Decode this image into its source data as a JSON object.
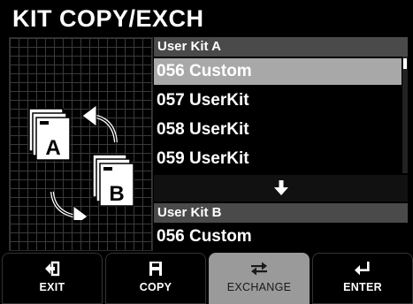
{
  "title": "KIT COPY/EXCH",
  "list": {
    "section_a": {
      "header": "User Kit A",
      "items": [
        {
          "label": "056 Custom",
          "selected": true
        },
        {
          "label": "057 UserKit",
          "selected": false
        },
        {
          "label": "058 UserKit",
          "selected": false
        },
        {
          "label": "059 UserKit",
          "selected": false
        }
      ]
    },
    "arrow_icon": "arrow-down-icon",
    "section_b": {
      "header": "User Kit B",
      "item": "056 Custom"
    }
  },
  "illustration": {
    "doc_a_letter": "A",
    "doc_b_letter": "B"
  },
  "softkeys": [
    {
      "label": "EXIT",
      "icon": "exit-icon",
      "active": false
    },
    {
      "label": "COPY",
      "icon": "save-icon",
      "active": false
    },
    {
      "label": "EXCHANGE",
      "icon": "exchange-icon",
      "active": true
    },
    {
      "label": "ENTER",
      "icon": "enter-icon",
      "active": false
    }
  ],
  "colors": {
    "background": "#000000",
    "header_bg": "#4a4a4a",
    "selected_bg": "#a8a8a8",
    "active_key_bg": "#9a9a9a",
    "grid": "#3a3a3a"
  }
}
